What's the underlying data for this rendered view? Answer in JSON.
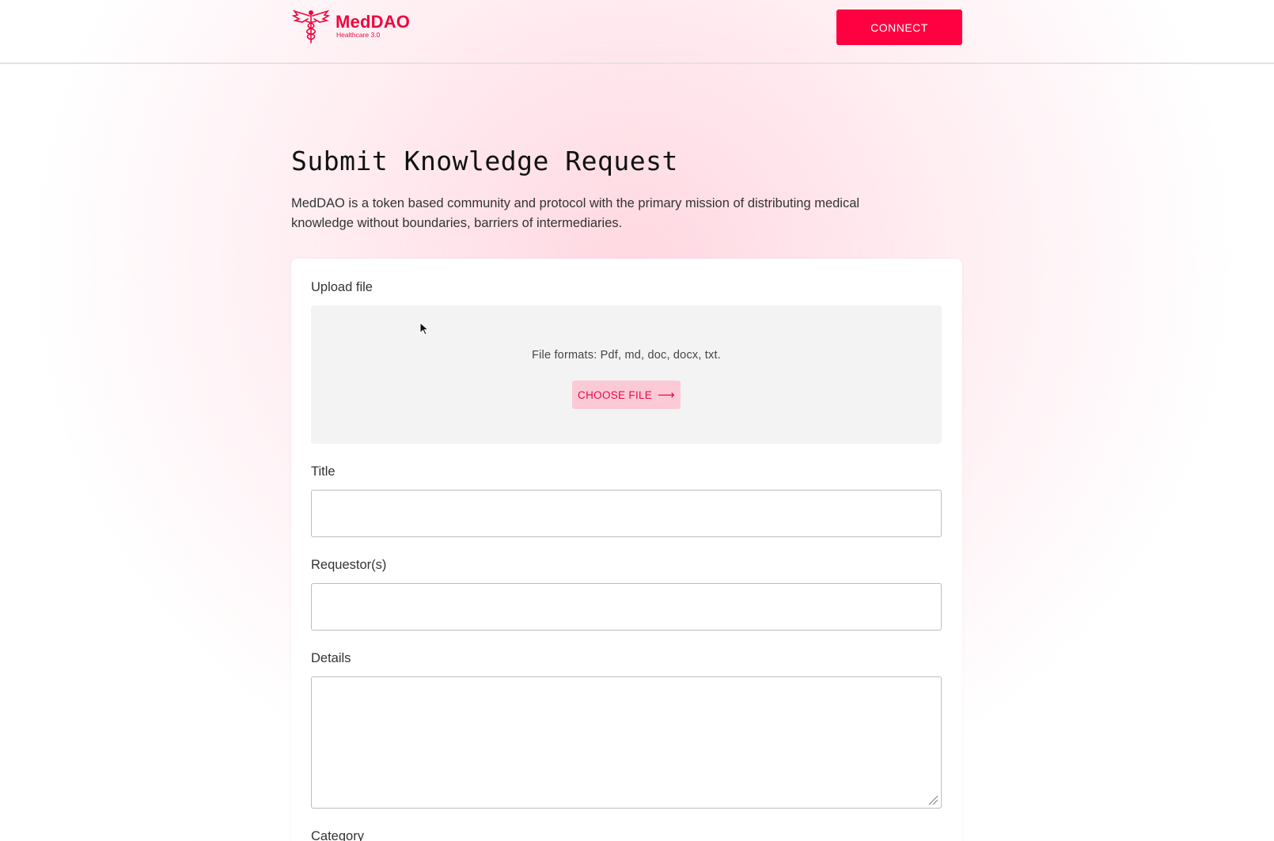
{
  "header": {
    "logo_name": "MedDAO",
    "logo_subtitle": "Healthcare 3.0",
    "connect_label": "CONNECT"
  },
  "hero": {
    "title": "Submit Knowledge Request",
    "description": "MedDAO is a token based community and protocol with the primary mission of distributing medical knowledge without boundaries, barriers of intermediaries."
  },
  "form": {
    "upload": {
      "label": "Upload file",
      "formats": "File formats: Pdf, md, doc, docx, txt.",
      "choose_label": "CHOOSE FILE",
      "choose_icon": "arrow-right-icon"
    },
    "title": {
      "label": "Title",
      "value": ""
    },
    "requestors": {
      "label": "Requestor(s)",
      "value": ""
    },
    "details": {
      "label": "Details",
      "value": ""
    },
    "category": {
      "label": "Category"
    }
  },
  "colors": {
    "brand": "#f0053e",
    "connect_bg": "#ff0040",
    "choose_bg": "#fccad7",
    "dropzone_bg": "#f3f3f3"
  },
  "icons": {
    "logo": "caduceus-icon",
    "cursor": "mouse-pointer-icon"
  }
}
